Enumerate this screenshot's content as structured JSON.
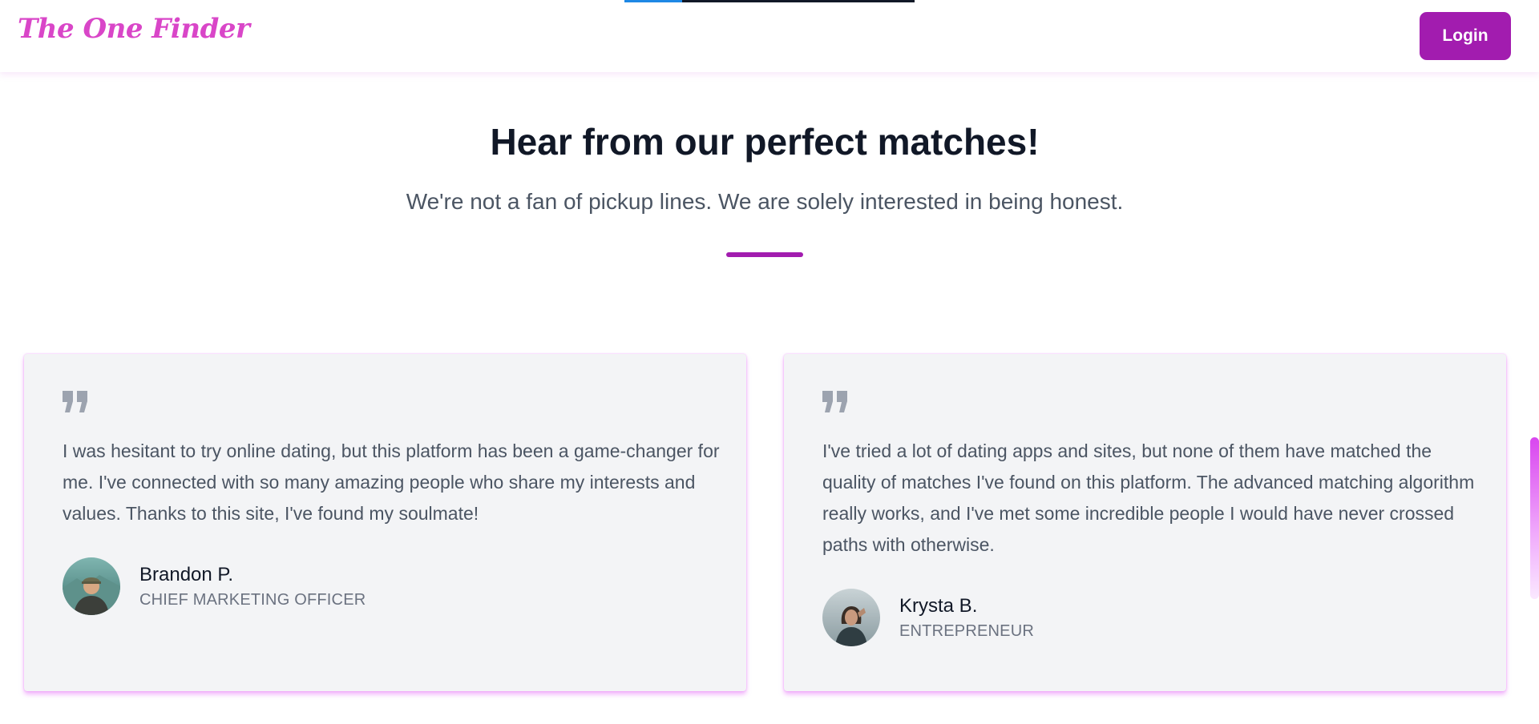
{
  "navbar": {
    "logo_text": "The One Finder",
    "login_label": "Login",
    "scroll_progress": 0.2
  },
  "section": {
    "title": "Hear from our perfect matches!",
    "subtitle": "We're not a fan of pickup lines. We are solely interested in being honest."
  },
  "testimonials": [
    {
      "quote": "I was hesitant to try online dating, but this platform has been a game-changer for me. I've connected with so many amazing people who share my interests and values. Thanks to this site, I've found my soulmate!",
      "name": "Brandon P.",
      "role": "CHIEF MARKETING OFFICER"
    },
    {
      "quote": "I've tried a lot of dating apps and sites, but none of them have matched the quality of matches I've found on this platform. The advanced matching algorithm really works, and I've met some incredible people I would have never crossed paths with otherwise.",
      "name": "Krysta B.",
      "role": "ENTREPRENEUR"
    }
  ],
  "icons": {
    "quote": "quote-icon",
    "avatar": "avatar"
  },
  "colors": {
    "brand": "#a21caf",
    "logo": "#d946c8",
    "card_bg": "#f3f4f6",
    "progress_fill": "#1e88e5"
  }
}
